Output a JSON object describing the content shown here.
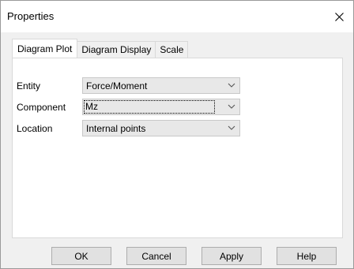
{
  "window": {
    "title": "Properties"
  },
  "tabs": [
    {
      "label": "Diagram Plot"
    },
    {
      "label": "Diagram Display"
    },
    {
      "label": "Scale"
    }
  ],
  "fields": [
    {
      "label": "Entity",
      "value": "Force/Moment"
    },
    {
      "label": "Component",
      "value": "Mz"
    },
    {
      "label": "Location",
      "value": "Internal points"
    }
  ],
  "buttons": {
    "ok": "OK",
    "cancel": "Cancel",
    "apply": "Apply",
    "help": "Help"
  },
  "icons": {
    "close": "close-icon",
    "dropdown": "chevron-down-icon"
  }
}
